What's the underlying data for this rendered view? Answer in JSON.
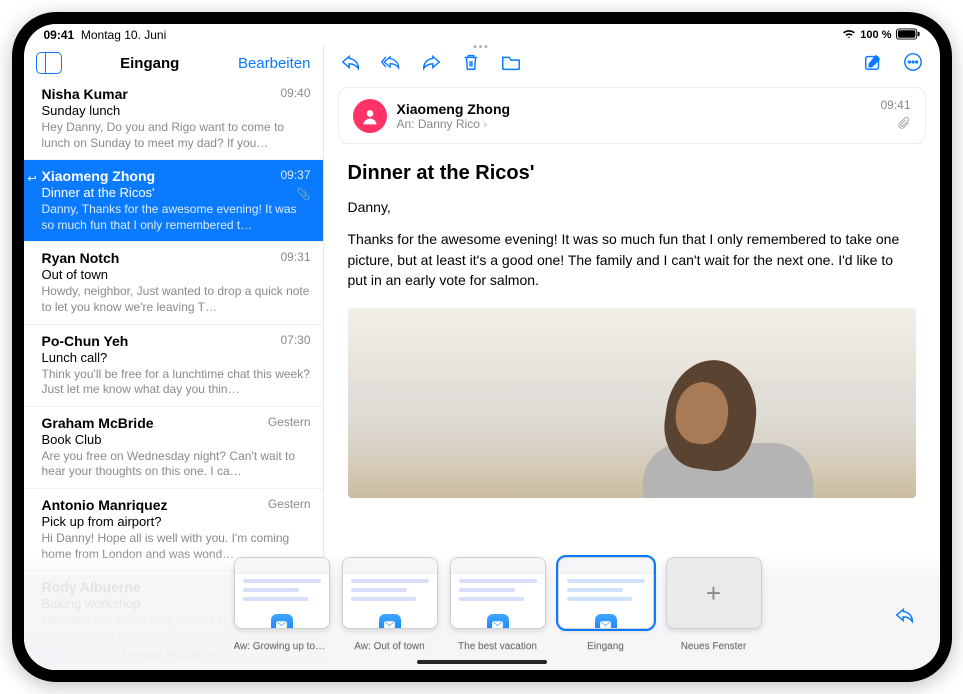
{
  "status": {
    "time": "09:41",
    "date": "Montag 10. Juni",
    "battery": "100 %"
  },
  "sidebar": {
    "title": "Eingang",
    "edit": "Bearbeiten",
    "footer": "Gerade aktualisiert",
    "items": [
      {
        "sender": "Nisha Kumar",
        "time": "09:40",
        "subject": "Sunday lunch",
        "preview": "Hey Danny, Do you and Rigo want to come to lunch on Sunday to meet my dad? If you…"
      },
      {
        "sender": "Xiaomeng Zhong",
        "time": "09:37",
        "subject": "Dinner at the Ricos'",
        "preview": "Danny, Thanks for the awesome evening! It was so much fun that I only remembered t…",
        "selected": true,
        "replied": true,
        "attachment": true
      },
      {
        "sender": "Ryan Notch",
        "time": "09:31",
        "subject": "Out of town",
        "preview": "Howdy, neighbor, Just wanted to drop a quick note to let you know we're leaving T…"
      },
      {
        "sender": "Po-Chun Yeh",
        "time": "07:30",
        "subject": "Lunch call?",
        "preview": "Think you'll be free for a lunchtime chat this week? Just let me know what day you thin…"
      },
      {
        "sender": "Graham McBride",
        "time": "Gestern",
        "subject": "Book Club",
        "preview": "Are you free on Wednesday night? Can't wait to hear your thoughts on this one. I ca…"
      },
      {
        "sender": "Antonio Manriquez",
        "time": "Gestern",
        "subject": "Pick up from airport?",
        "preview": "Hi Danny! Hope all is well with you. I'm coming home from London and was wond…"
      },
      {
        "sender": "Rody Albuerne",
        "time": "Gestern",
        "subject": "Baking workshop",
        "preview": "Hello Bakers, We're very excited to have you all join us for our baking workshop…"
      }
    ]
  },
  "message": {
    "from": "Xiaomeng Zhong",
    "to_label": "An:",
    "to_name": "Danny Rico",
    "time": "09:41",
    "subject": "Dinner at the Ricos'",
    "greeting": "Danny,",
    "body": "Thanks for the awesome evening! It was so much fun that I only remembered to take one picture, but at least it's a good one! The family and I can't wait for the next one. I'd like to put in an early vote for salmon."
  },
  "shelf": [
    {
      "label": "Aw: Growing up too fast"
    },
    {
      "label": "Aw: Out of town"
    },
    {
      "label": "The best vacation"
    },
    {
      "label": "Eingang",
      "active": true
    },
    {
      "label": "Neues Fenster",
      "new": true
    }
  ]
}
